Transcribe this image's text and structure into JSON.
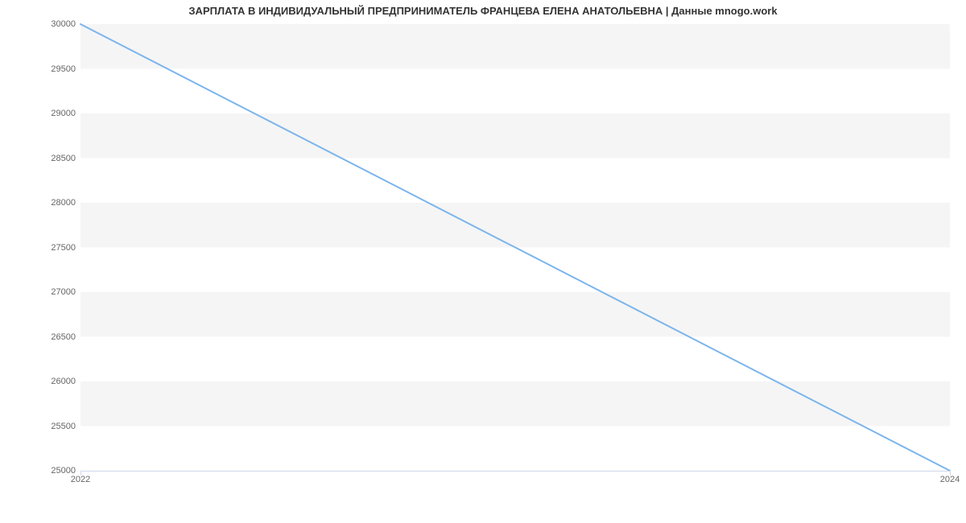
{
  "chart_data": {
    "type": "line",
    "title": "ЗАРПЛАТА В ИНДИВИДУАЛЬНЫЙ ПРЕДПРИНИМАТЕЛЬ ФРАНЦЕВА ЕЛЕНА АНАТОЛЬЕВНА | Данные mnogo.work",
    "x": [
      2022,
      2024
    ],
    "values": [
      30000,
      25000
    ],
    "xlabel": "",
    "ylabel": "",
    "ylim": [
      25000,
      30000
    ],
    "xlim": [
      2022,
      2024
    ],
    "y_ticks": [
      25000,
      25500,
      26000,
      26500,
      27000,
      27500,
      28000,
      28500,
      29000,
      29500,
      30000
    ],
    "x_ticks": [
      2022,
      2024
    ],
    "line_color": "#7cb5ec"
  }
}
